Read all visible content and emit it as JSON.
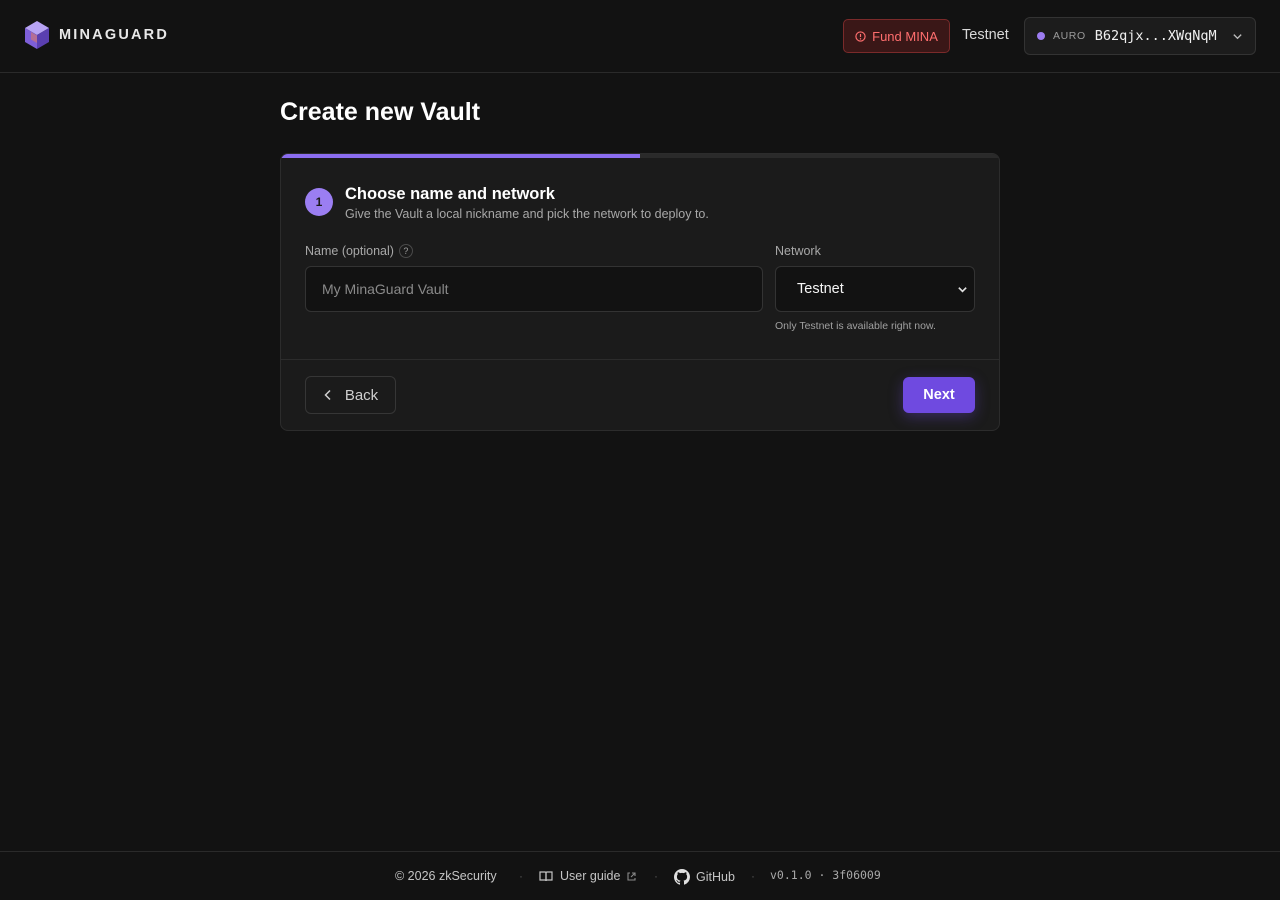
{
  "header": {
    "brand": "MINAGUARD",
    "fund_label": "Fund MINA",
    "network_label": "Testnet",
    "wallet": {
      "provider": "AURO",
      "address": "B62qjx...XWqNqM",
      "status_color": "#9c7cf0"
    }
  },
  "main": {
    "title": "Create new Vault",
    "progress": 0.5,
    "step": {
      "number": "1",
      "title": "Choose name and network",
      "description": "Give the Vault a local nickname and pick the network to deploy to."
    },
    "name_field": {
      "label": "Name (optional)",
      "help": "?",
      "placeholder": "My MinaGuard Vault",
      "value": ""
    },
    "network_field": {
      "label": "Network",
      "selected": "Testnet",
      "hint": "Only Testnet is available right now."
    },
    "back_label": "Back",
    "next_label": "Next"
  },
  "footer": {
    "copyright": "© 2026 zkSecurity",
    "user_guide": "User guide",
    "github": "GitHub",
    "version": "v0.1.0 · 3f06009"
  },
  "colors": {
    "accent": "#6f4ae0",
    "accent_light": "#9b7ef2",
    "danger": "#ff6e6e",
    "background": "#121212"
  },
  "icons": [
    "minaguard-logo-icon",
    "warning-icon",
    "chevron-down-icon",
    "chevron-left-icon",
    "book-icon",
    "external-link-icon",
    "github-icon"
  ]
}
